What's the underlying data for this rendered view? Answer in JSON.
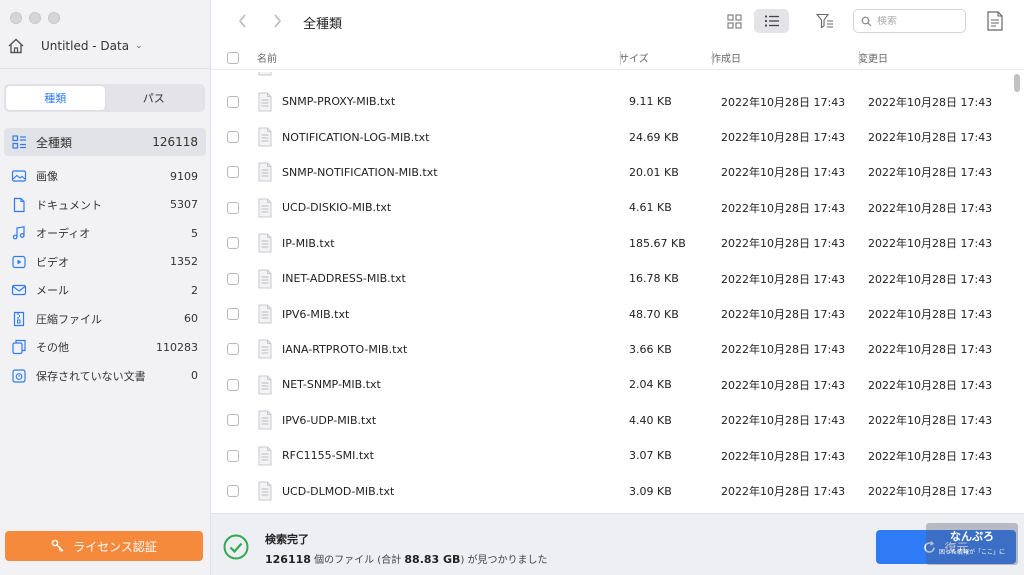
{
  "sidebar": {
    "volume_name": "Untitled - Data",
    "segments": [
      "種類",
      "パス"
    ],
    "categories": [
      {
        "label": "全種類",
        "count": "126118",
        "icon": "all-types-icon"
      },
      {
        "label": "画像",
        "count": "9109",
        "icon": "image-icon"
      },
      {
        "label": "ドキュメント",
        "count": "5307",
        "icon": "document-icon"
      },
      {
        "label": "オーディオ",
        "count": "5",
        "icon": "audio-icon"
      },
      {
        "label": "ビデオ",
        "count": "1352",
        "icon": "video-icon"
      },
      {
        "label": "メール",
        "count": "2",
        "icon": "mail-icon"
      },
      {
        "label": "圧縮ファイル",
        "count": "60",
        "icon": "archive-icon"
      },
      {
        "label": "その他",
        "count": "110283",
        "icon": "other-icon"
      },
      {
        "label": "保存されていない文書",
        "count": "0",
        "icon": "unsaved-doc-icon"
      }
    ],
    "license_label": "ライセンス認証"
  },
  "toolbar": {
    "title": "全種類",
    "search_placeholder": "検索"
  },
  "table": {
    "headers": {
      "name": "名前",
      "size": "サイズ",
      "created": "作成日",
      "modified": "変更日"
    },
    "rows": [
      {
        "name": "SNMP-PROXY-MIB.txt",
        "size": "9.11 KB",
        "created": "2022年10月28日 17:43",
        "modified": "2022年10月28日 17:43"
      },
      {
        "name": "NOTIFICATION-LOG-MIB.txt",
        "size": "24.69 KB",
        "created": "2022年10月28日 17:43",
        "modified": "2022年10月28日 17:43"
      },
      {
        "name": "SNMP-NOTIFICATION-MIB.txt",
        "size": "20.01 KB",
        "created": "2022年10月28日 17:43",
        "modified": "2022年10月28日 17:43"
      },
      {
        "name": "UCD-DISKIO-MIB.txt",
        "size": "4.61 KB",
        "created": "2022年10月28日 17:43",
        "modified": "2022年10月28日 17:43"
      },
      {
        "name": "IP-MIB.txt",
        "size": "185.67 KB",
        "created": "2022年10月28日 17:43",
        "modified": "2022年10月28日 17:43"
      },
      {
        "name": "INET-ADDRESS-MIB.txt",
        "size": "16.78 KB",
        "created": "2022年10月28日 17:43",
        "modified": "2022年10月28日 17:43"
      },
      {
        "name": "IPV6-MIB.txt",
        "size": "48.70 KB",
        "created": "2022年10月28日 17:43",
        "modified": "2022年10月28日 17:43"
      },
      {
        "name": "IANA-RTPROTO-MIB.txt",
        "size": "3.66 KB",
        "created": "2022年10月28日 17:43",
        "modified": "2022年10月28日 17:43"
      },
      {
        "name": "NET-SNMP-MIB.txt",
        "size": "2.04 KB",
        "created": "2022年10月28日 17:43",
        "modified": "2022年10月28日 17:43"
      },
      {
        "name": "IPV6-UDP-MIB.txt",
        "size": "4.40 KB",
        "created": "2022年10月28日 17:43",
        "modified": "2022年10月28日 17:43"
      },
      {
        "name": "RFC1155-SMI.txt",
        "size": "3.07 KB",
        "created": "2022年10月28日 17:43",
        "modified": "2022年10月28日 17:43"
      },
      {
        "name": "UCD-DLMOD-MIB.txt",
        "size": "3.09 KB",
        "created": "2022年10月28日 17:43",
        "modified": "2022年10月28日 17:43"
      }
    ]
  },
  "status": {
    "title": "検索完了",
    "file_count": "126118",
    "text_a": "個のファイル (合計",
    "total_size": "88.83 GB",
    "text_b": ") が見つかりました",
    "recover_label": "復元"
  },
  "watermark": {
    "line1": "なんぷろ",
    "line2": "困った情報が「ここ」に"
  },
  "colors": {
    "accent": "#2f7bf5",
    "license": "#f58a3d",
    "success": "#34a853"
  }
}
